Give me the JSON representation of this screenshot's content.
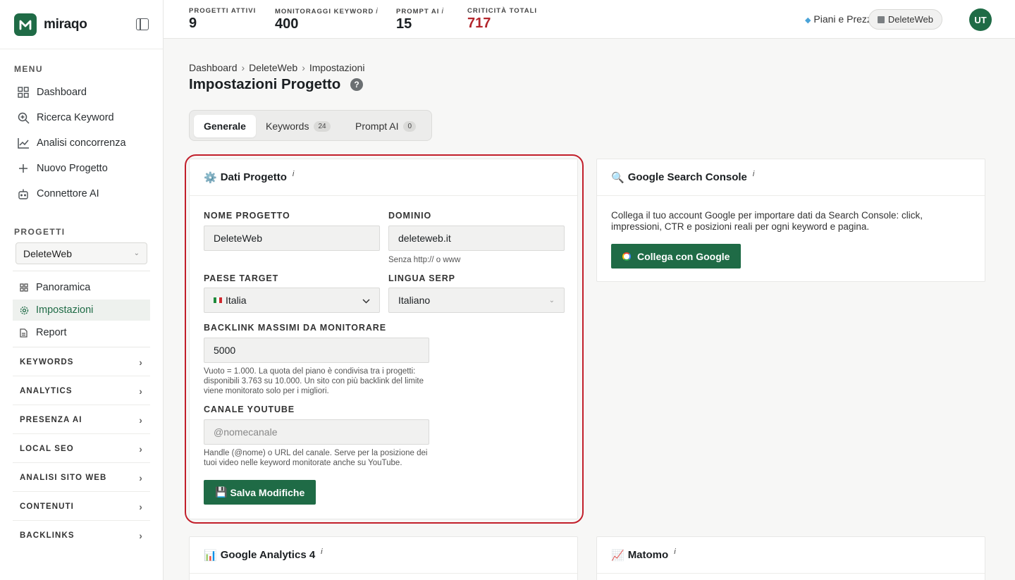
{
  "brand": {
    "name": "miraqo"
  },
  "sidebar": {
    "menu_label": "MENU",
    "menu": [
      {
        "label": "Dashboard",
        "icon": "grid-icon"
      },
      {
        "label": "Ricerca Keyword",
        "icon": "search-plus-icon"
      },
      {
        "label": "Analisi concorrenza",
        "icon": "chart-line-icon"
      },
      {
        "label": "Nuovo Progetto",
        "icon": "plus-icon"
      },
      {
        "label": "Connettore AI",
        "icon": "robot-icon"
      }
    ],
    "projects_label": "PROGETTI",
    "project_select": "DeleteWeb",
    "project_items": [
      {
        "label": "Panoramica",
        "icon": "grid-icon"
      },
      {
        "label": "Impostazioni",
        "icon": "gear-icon"
      },
      {
        "label": "Report",
        "icon": "document-icon"
      }
    ],
    "groups": [
      "KEYWORDS",
      "ANALYTICS",
      "PRESENZA AI",
      "LOCAL SEO",
      "ANALISI SITO WEB",
      "CONTENUTI",
      "BACKLINKS"
    ]
  },
  "header": {
    "stats": [
      {
        "label": "PROGETTI ATTIVI",
        "value": "9",
        "info": ""
      },
      {
        "label": "MONITORAGGI KEYWORD",
        "value": "400",
        "info": "i"
      },
      {
        "label": "PROMPT AI",
        "value": "15",
        "info": "i"
      },
      {
        "label": "CRITICITÀ TOTALI",
        "value": "717",
        "info": ""
      }
    ],
    "plans": "Piani e Prezzi",
    "project_chip": "DeleteWeb",
    "avatar": "UT"
  },
  "breadcrumb": [
    "Dashboard",
    "DeleteWeb",
    "Impostazioni"
  ],
  "page_title": "Impostazioni Progetto",
  "help": "?",
  "tabs": [
    {
      "label": "Generale",
      "badge": ""
    },
    {
      "label": "Keywords",
      "badge": "24"
    },
    {
      "label": "Prompt AI",
      "badge": "0"
    }
  ],
  "project_card": {
    "emoji": "⚙️",
    "title": "Dati Progetto",
    "info": "i",
    "name_label": "NOME PROGETTO",
    "name_value": "DeleteWeb",
    "domain_label": "DOMINIO",
    "domain_value": "deleteweb.it",
    "domain_hint": "Senza http:// o www",
    "country_label": "PAESE TARGET",
    "country_value": "Italia",
    "lang_label": "LINGUA SERP",
    "lang_value": "Italiano",
    "backlink_label": "BACKLINK MASSIMI DA MONITORARE",
    "backlink_value": "5000",
    "backlink_hint": "Vuoto = 1.000. La quota del piano è condivisa tra i progetti: disponibili 3.763 su 10.000. Un sito con più backlink del limite viene monitorato solo per i migliori.",
    "youtube_label": "CANALE YOUTUBE",
    "youtube_placeholder": "@nomecanale",
    "youtube_hint": "Handle (@nome) o URL del canale. Serve per la posizione dei tuoi video nelle keyword monitorate anche su YouTube.",
    "save_emoji": "💾",
    "save_label": "Salva Modifiche"
  },
  "gsc_card": {
    "emoji": "🔍",
    "title": "Google Search Console",
    "info": "i",
    "text": "Collega il tuo account Google per importare dati da Search Console: click, impressioni, CTR e posizioni reali per ogni keyword e pagina.",
    "button": "Collega con Google"
  },
  "ga_card": {
    "emoji": "📊",
    "title": "Google Analytics 4",
    "info": "i"
  },
  "matomo_card": {
    "emoji": "📈",
    "title": "Matomo",
    "info": "i"
  },
  "colors": {
    "brand": "#1f6b46",
    "alert": "#b3262c",
    "highlight": "#c21f2b"
  }
}
